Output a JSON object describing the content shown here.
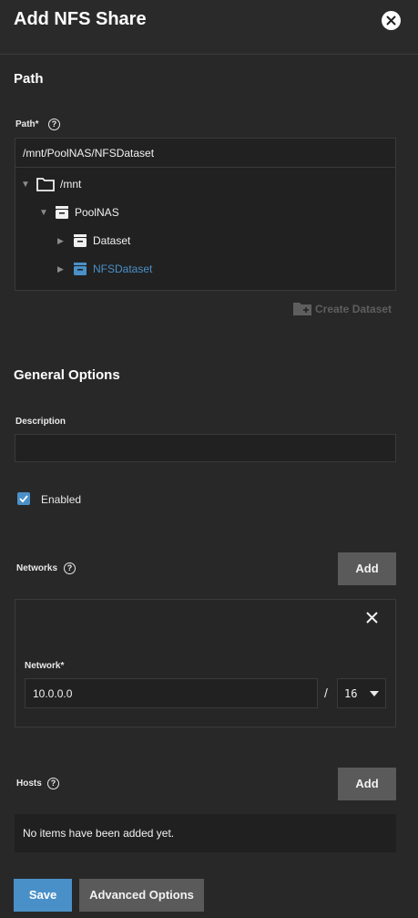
{
  "header": {
    "title": "Add NFS Share"
  },
  "path_section": {
    "title": "Path",
    "label": "Path",
    "required": "*",
    "value": "/mnt/PoolNAS/NFSDataset",
    "tree": [
      {
        "label": "/mnt",
        "icon": "folder-icon"
      },
      {
        "label": "PoolNAS",
        "icon": "dataset-icon"
      },
      {
        "label": "Dataset",
        "icon": "dataset-icon"
      },
      {
        "label": "NFSDataset",
        "icon": "dataset-icon",
        "selected": true
      }
    ],
    "create_dataset_label": "Create Dataset"
  },
  "general": {
    "title": "General Options",
    "description_label": "Description",
    "description_value": "",
    "enabled_label": "Enabled",
    "enabled": true
  },
  "networks": {
    "label": "Networks",
    "add_label": "Add",
    "network_label": "Network",
    "required": "*",
    "network_value": "10.0.0.0",
    "separator": "/",
    "mask_value": "16"
  },
  "hosts": {
    "label": "Hosts",
    "add_label": "Add",
    "empty_text": "No items have been added yet."
  },
  "footer": {
    "save_label": "Save",
    "advanced_label": "Advanced Options"
  },
  "colors": {
    "accent": "#4a90c8",
    "background": "#282828",
    "field_background": "#212121",
    "selected_text": "#4a90c8"
  }
}
